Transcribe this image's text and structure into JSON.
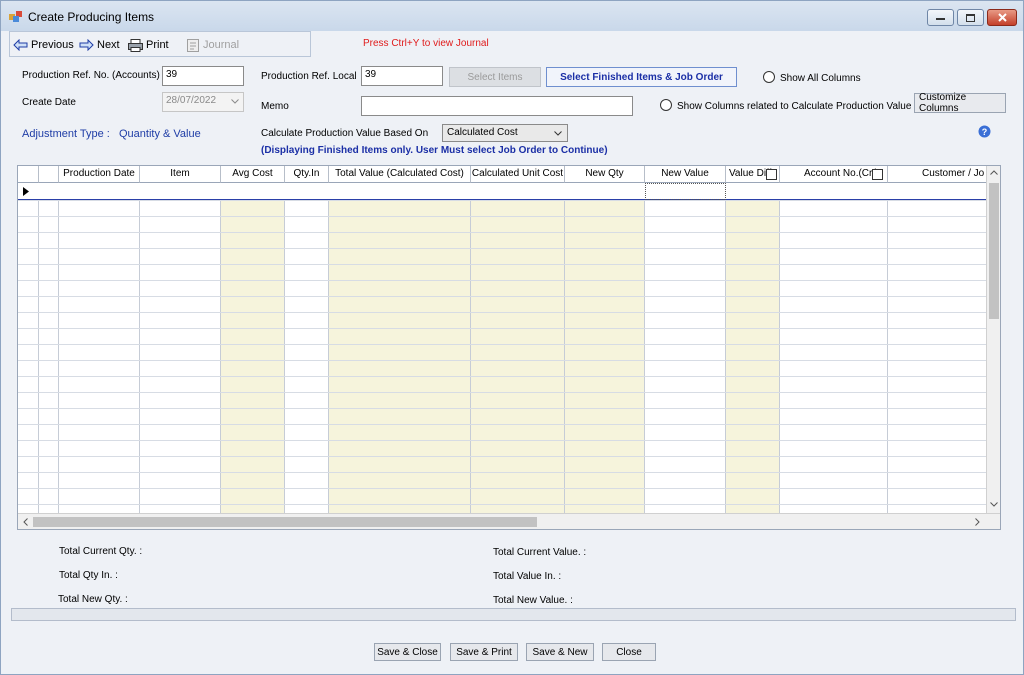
{
  "window": {
    "title": "Create Producing Items"
  },
  "toolbar": {
    "previous": "Previous",
    "next": "Next",
    "print": "Print",
    "journal": "Journal",
    "hint": "Press Ctrl+Y to view Journal"
  },
  "form": {
    "prod_ref_accounts_label": "Production Ref. No. (Accounts)",
    "prod_ref_accounts_value": "39",
    "prod_ref_local_label": "Production Ref. Local",
    "prod_ref_local_value": "39",
    "select_items_label": "Select Items",
    "select_finished_label": "Select Finished Items & Job Order",
    "show_all_columns_label": "Show All Columns",
    "create_date_label": "Create Date",
    "create_date_value": "28/07/2022",
    "memo_label": "Memo",
    "memo_value": "",
    "show_columns_prod_value_label": "Show Columns related to Calculate Production Value",
    "customize_columns_label": "Customize Columns",
    "adjustment_type_label": "Adjustment Type :",
    "adjustment_type_value": "Quantity & Value",
    "calc_based_on_label": "Calculate Production Value Based On",
    "calc_based_on_value": "Calculated Cost",
    "note": "(Displaying Finished Items only. User Must select Job Order to Continue)"
  },
  "grid": {
    "columns": [
      "Production Date",
      "Item",
      "Avg Cost",
      "Qty.In",
      "Total Value (Calculated Cost)",
      "Calculated Unit Cost",
      "New Qty",
      "New  Value",
      "Value Diff.",
      "Account No.(Cr.)",
      "Customer / Jo"
    ]
  },
  "totals": {
    "current_qty": "Total Current Qty. :",
    "qty_in": "Total Qty In. :",
    "new_qty": "Total New Qty. :",
    "current_value": "Total Current Value. :",
    "value_in": "Total Value In. :",
    "new_value": "Total New Value. :"
  },
  "buttons": {
    "save_close": "Save & Close",
    "save_print": "Save & Print",
    "save_new": "Save & New",
    "close": "Close"
  },
  "colors": {
    "accent_blue": "#1b2fa6",
    "hint_red": "#e01b1b",
    "shaded_column": "#f6f4dc"
  }
}
